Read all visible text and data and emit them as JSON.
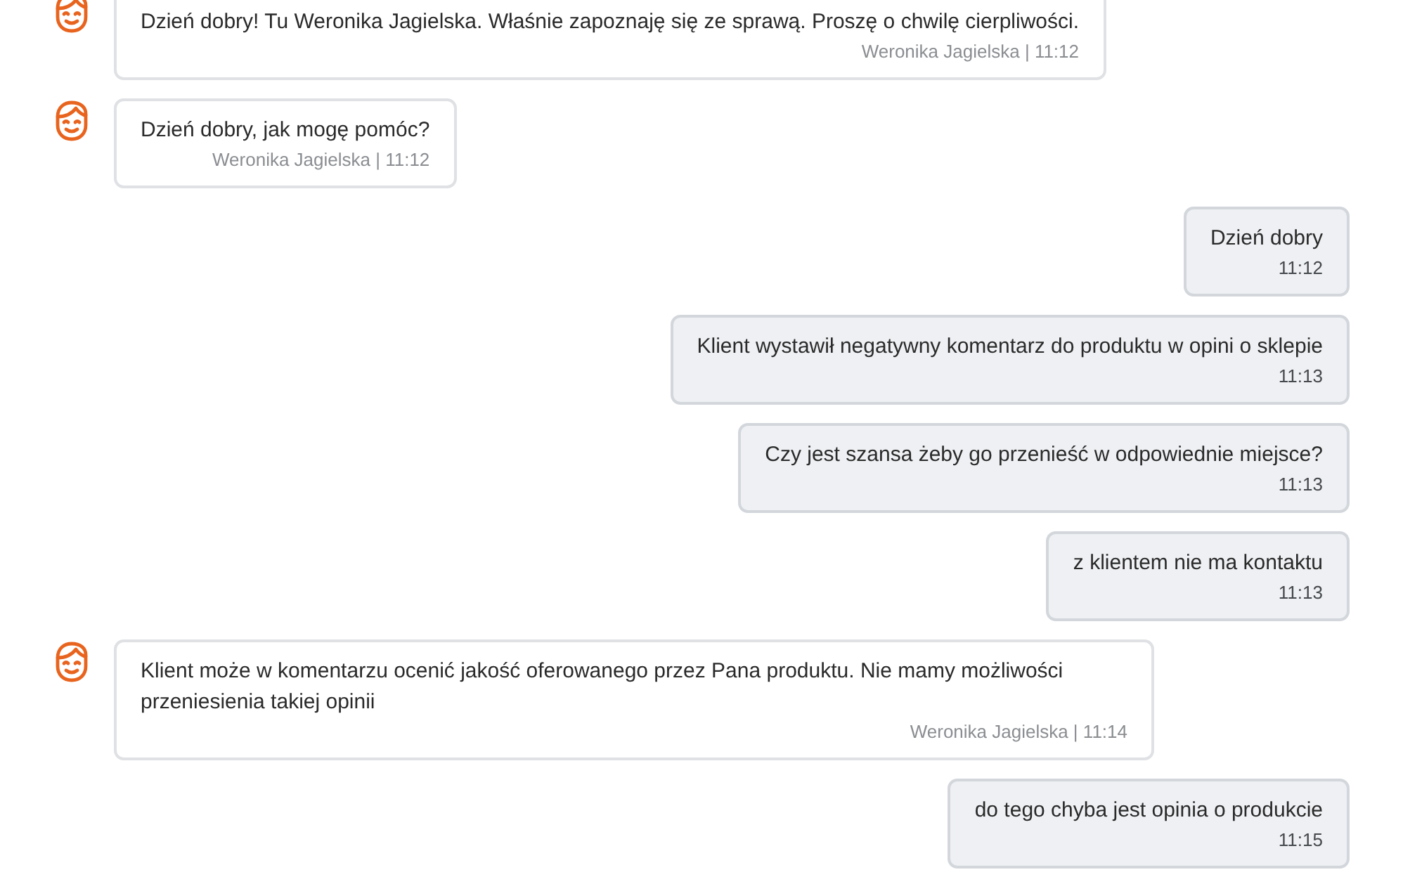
{
  "messages": [
    {
      "kind": "agent",
      "text": "Dzień dobry! Tu Weronika Jagielska. Właśnie zapoznaję się ze sprawą. Proszę o chwilę cierpliwości.",
      "meta": "Weronika Jagielska | 11:12"
    },
    {
      "kind": "agent",
      "text": "Dzień dobry, jak mogę pomóc?",
      "meta": "Weronika Jagielska | 11:12"
    },
    {
      "kind": "user",
      "text": "Dzień dobry",
      "meta": "11:12"
    },
    {
      "kind": "user",
      "text": "Klient wystawił negatywny komentarz do produktu w opini o sklepie",
      "meta": "11:13"
    },
    {
      "kind": "user",
      "text": "Czy jest szansa żeby go przenieść w odpowiednie miejsce?",
      "meta": "11:13"
    },
    {
      "kind": "user",
      "text": "z klientem nie ma kontaktu",
      "meta": "11:13"
    },
    {
      "kind": "agent",
      "text": "Klient może w komentarzu ocenić jakość oferowanego przez Pana produktu. Nie mamy możliwości przeniesienia takiej opinii",
      "meta": "Weronika Jagielska | 11:14"
    },
    {
      "kind": "user",
      "text": "do tego chyba jest opinia o produkcie",
      "meta": "11:15"
    }
  ]
}
